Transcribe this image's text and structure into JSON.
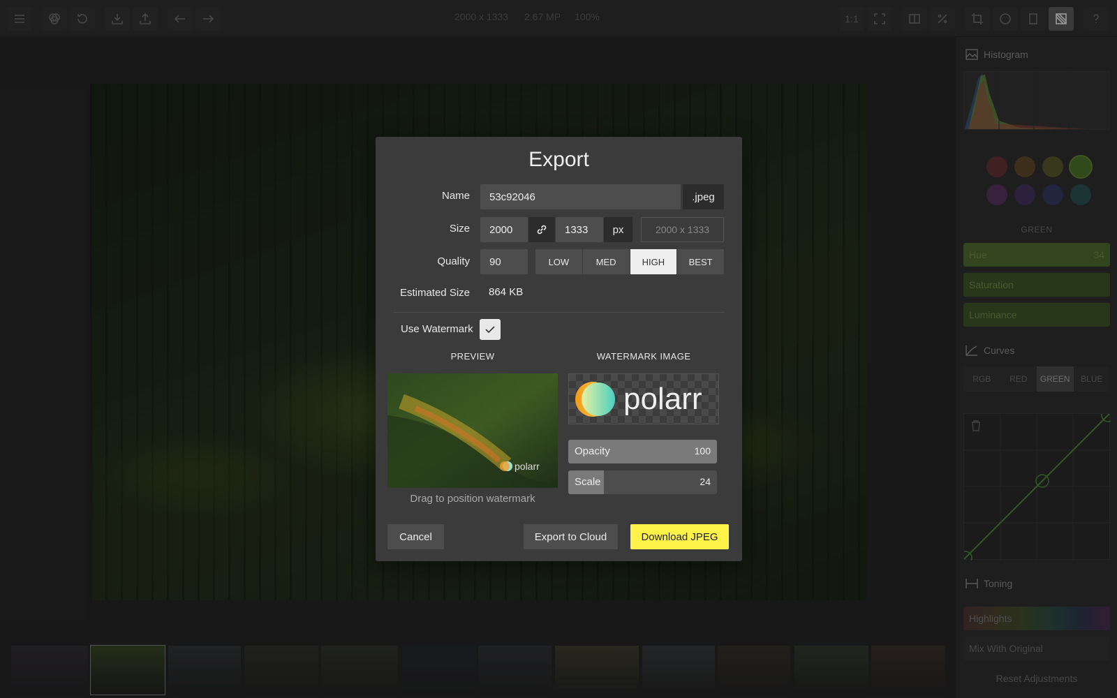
{
  "toolbar": {
    "info": {
      "dimensions": "2000 x 1333",
      "megapixels": "2.67 MP",
      "zoom": "100%"
    },
    "ratio_label": "1:1",
    "left_icons": [
      "menu-icon",
      "filters-icon",
      "history-icon",
      "import-icon",
      "share-icon",
      "undo-icon",
      "redo-icon"
    ],
    "right_icons": [
      "one-to-one-icon",
      "fullscreen-icon",
      "compare-icon",
      "percent-icon",
      "crop-icon",
      "circle-mask-icon",
      "frame-icon",
      "local-adjust-icon",
      "help-icon"
    ]
  },
  "dialog": {
    "title": "Export",
    "name_label": "Name",
    "name_value": "53c92046",
    "extension": ".jpeg",
    "size_label": "Size",
    "width": "2000",
    "height": "1333",
    "unit": "px",
    "size_placeholder": "2000 x 1333",
    "quality_label": "Quality",
    "quality_value": "90",
    "quality_options": [
      "LOW",
      "MED",
      "HIGH",
      "BEST"
    ],
    "quality_selected": "HIGH",
    "estimated_label": "Estimated Size",
    "estimated_value": "864 KB",
    "watermark_label": "Use Watermark",
    "watermark_checked": true,
    "preview_heading": "PREVIEW",
    "watermark_heading": "WATERMARK IMAGE",
    "watermark_logo_text": "polarr",
    "opacity_label": "Opacity",
    "opacity_value": "100",
    "opacity_level": 1.0,
    "scale_label": "Scale",
    "scale_value": "24",
    "scale_level": 0.24,
    "drag_hint": "Drag to position watermark",
    "cancel_label": "Cancel",
    "cloud_label": "Export to Cloud",
    "download_label": "Download JPEG"
  },
  "panel": {
    "histogram_title": "Histogram",
    "color_swatches": [
      "#a03a3a",
      "#9a6a2a",
      "#8a8a2a",
      "#4e7a2a",
      "#8a3a9a",
      "#5a3a9a",
      "#3a4a9a",
      "#2a7a7a"
    ],
    "selected_color": "GREEN",
    "hue_label": "Hue",
    "hue_value": "34",
    "saturation_label": "Saturation",
    "luminance_label": "Luminance",
    "curves_title": "Curves",
    "curve_channels": [
      "RGB",
      "RED",
      "GREEN",
      "BLUE"
    ],
    "curve_selected": "GREEN",
    "toning_title": "Toning",
    "highlights_label": "Highlights",
    "mix_label": "Mix With Original",
    "reset_label": "Reset Adjustments"
  },
  "filmstrip": {
    "thumb_colors": [
      "#3a3540",
      "#3a4a28",
      "#3e4246",
      "#3a3d35",
      "#3c4036",
      "#262d38",
      "#3a3c44",
      "#545236",
      "#4a4d52",
      "#3e3a30",
      "#3e4a38",
      "#4a3a32"
    ],
    "active_index": 1
  },
  "colors": {
    "accent_yellow": "#fff34a",
    "panel_green": "#4e6a2e"
  }
}
